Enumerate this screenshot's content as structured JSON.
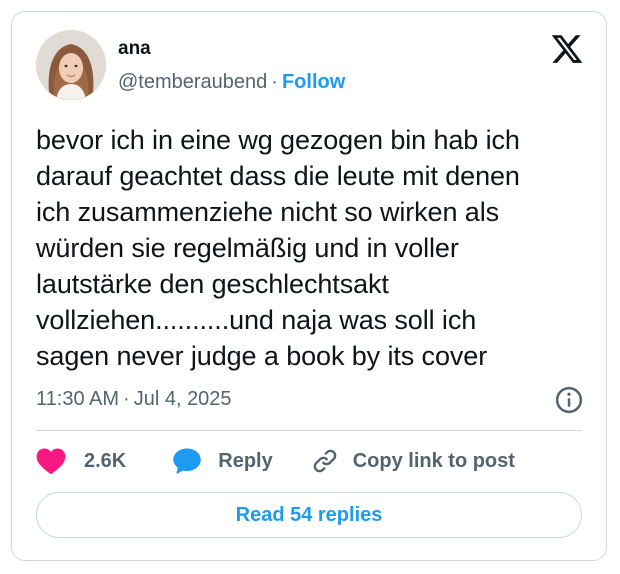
{
  "author": {
    "name": "ana",
    "handle": "@temberaubend",
    "separator": "·",
    "follow_label": "Follow",
    "avatar_icon": "profile-photo"
  },
  "brand": {
    "logo_icon": "x-logo-icon"
  },
  "tweet": {
    "text": "bevor ich in eine wg gezogen bin hab ich\ndarauf geachtet dass die leute mit denen\nich zusammenziehe nicht so wirken als\nwürden sie regelmäßig und in voller\nlautstärke den geschlechtsakt\nvollziehen..........und naja was soll ich\nsagen never judge a book by its cover",
    "time": "11:30 AM",
    "separator": "·",
    "date": "Jul 4, 2025"
  },
  "actions": {
    "like_count": "2.6K",
    "reply_label": "Reply",
    "copy_label": "Copy link to post",
    "read_replies_label": "Read 54 replies"
  },
  "colors": {
    "accent": "#1d9bf0",
    "heart": "#f91880",
    "text": "#0f1419",
    "muted": "#536471",
    "border": "#cfd9de"
  }
}
